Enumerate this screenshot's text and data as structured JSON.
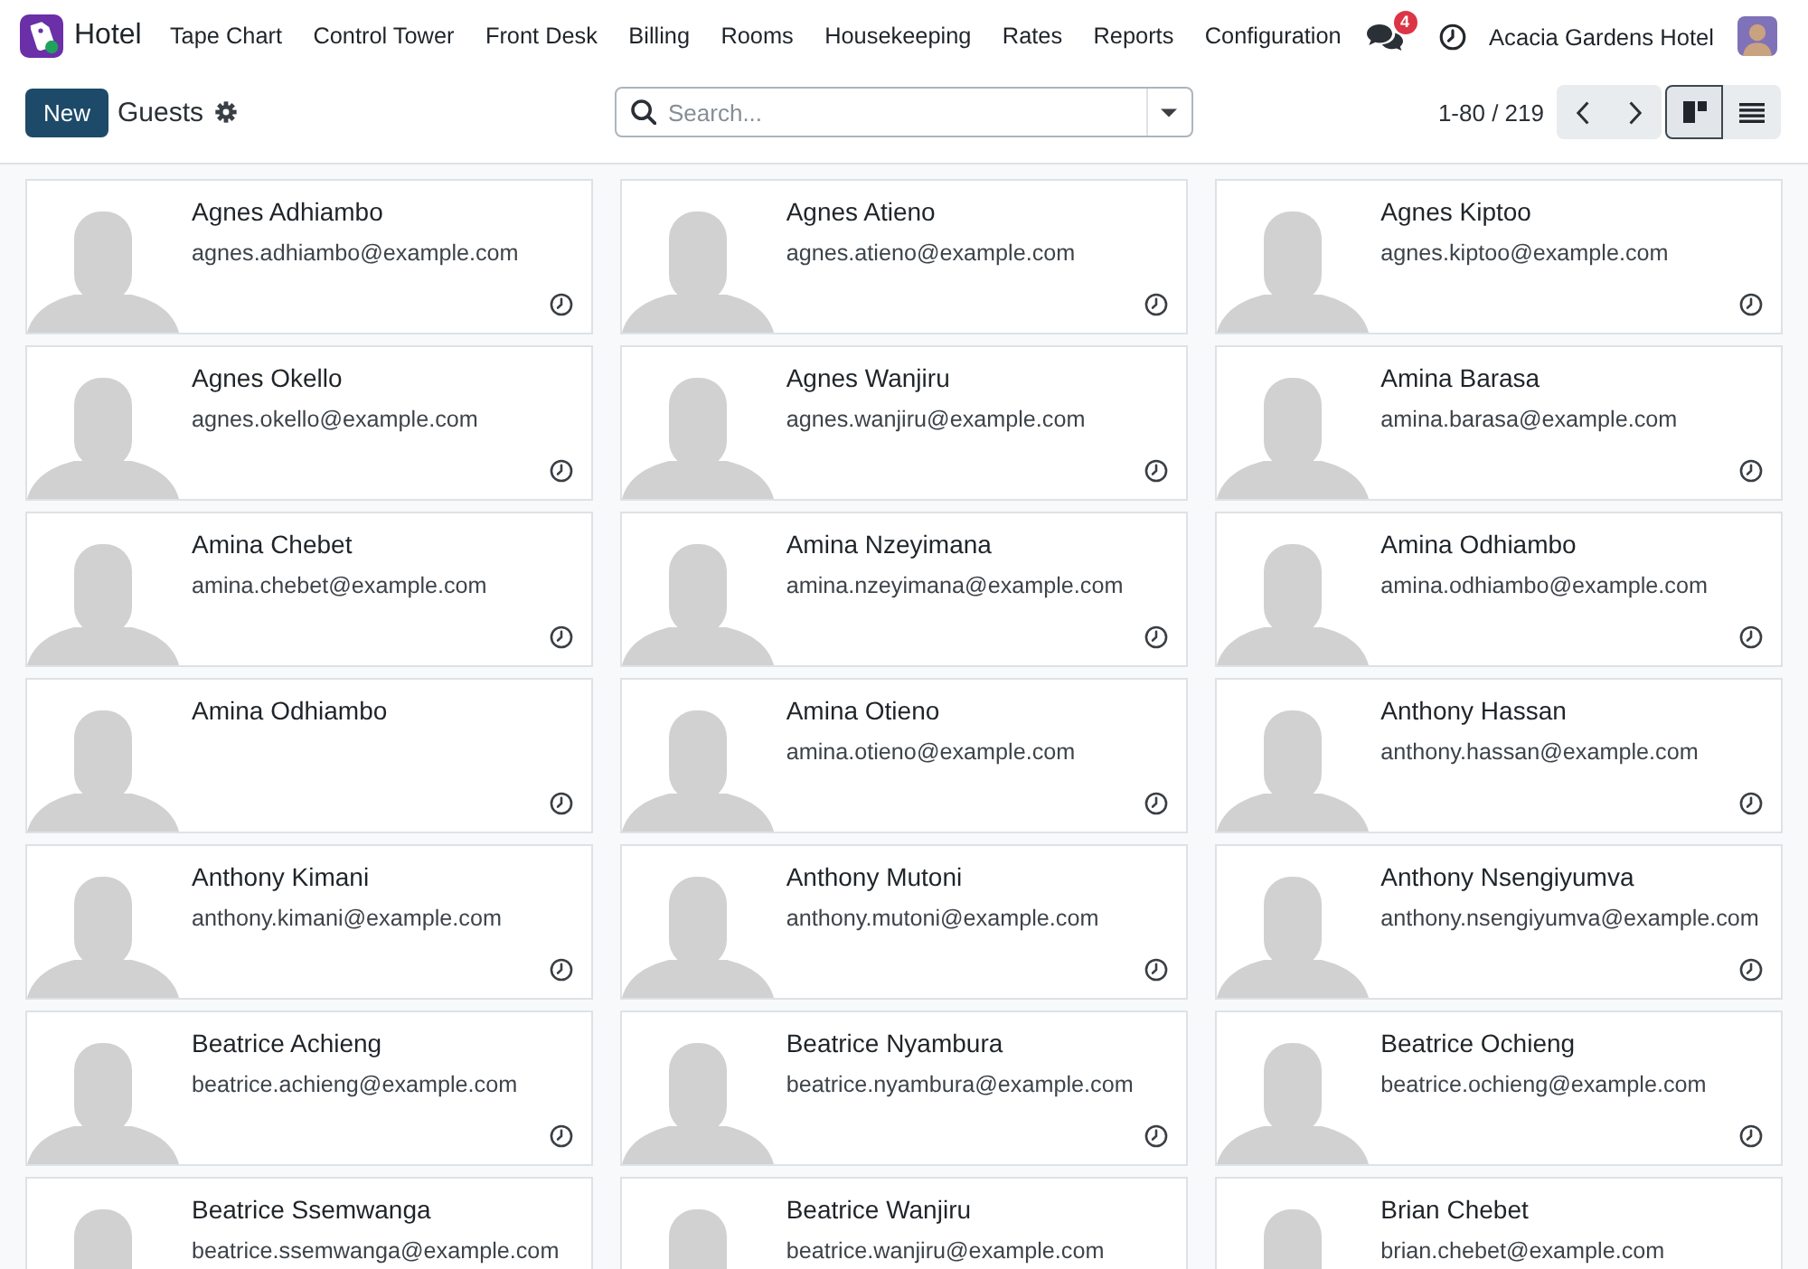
{
  "app": {
    "name": "Hotel"
  },
  "menu": [
    "Tape Chart",
    "Control Tower",
    "Front Desk",
    "Billing",
    "Rooms",
    "Housekeeping",
    "Rates",
    "Reports",
    "Configuration"
  ],
  "systray": {
    "messages_badge": "4",
    "company": "Acacia Gardens Hotel"
  },
  "control_panel": {
    "new_button": "New",
    "title": "Guests",
    "search": {
      "placeholder": "Search..."
    },
    "pager": "1-80 / 219",
    "views": [
      {
        "kind": "kanban",
        "selected": true
      },
      {
        "kind": "list",
        "selected": false
      }
    ]
  },
  "cards": [
    {
      "name": "Agnes Adhiambo",
      "email": "agnes.adhiambo@example.com"
    },
    {
      "name": "Agnes Atieno",
      "email": "agnes.atieno@example.com"
    },
    {
      "name": "Agnes Kiptoo",
      "email": "agnes.kiptoo@example.com"
    },
    {
      "name": "Agnes Okello",
      "email": "agnes.okello@example.com"
    },
    {
      "name": "Agnes Wanjiru",
      "email": "agnes.wanjiru@example.com"
    },
    {
      "name": "Amina Barasa",
      "email": "amina.barasa@example.com"
    },
    {
      "name": "Amina Chebet",
      "email": "amina.chebet@example.com"
    },
    {
      "name": "Amina Nzeyimana",
      "email": "amina.nzeyimana@example.com"
    },
    {
      "name": "Amina Odhiambo",
      "email": "amina.odhiambo@example.com"
    },
    {
      "name": "Amina Odhiambo"
    },
    {
      "name": "Amina Otieno",
      "email": "amina.otieno@example.com"
    },
    {
      "name": "Anthony Hassan",
      "email": "anthony.hassan@example.com"
    },
    {
      "name": "Anthony Kimani",
      "email": "anthony.kimani@example.com"
    },
    {
      "name": "Anthony Mutoni",
      "email": "anthony.mutoni@example.com"
    },
    {
      "name": "Anthony Nsengiyumva",
      "email": "anthony.nsengiyumva@example.com"
    },
    {
      "name": "Beatrice Achieng",
      "email": "beatrice.achieng@example.com"
    },
    {
      "name": "Beatrice Nyambura",
      "email": "beatrice.nyambura@example.com"
    },
    {
      "name": "Beatrice Ochieng",
      "email": "beatrice.ochieng@example.com"
    },
    {
      "name": "Beatrice Ssemwanga",
      "email": "beatrice.ssemwanga@example.com"
    },
    {
      "name": "Beatrice Wanjiru",
      "email": "beatrice.wanjiru@example.com"
    },
    {
      "name": "Brian Chebet",
      "email": "brian.chebet@example.com"
    }
  ]
}
